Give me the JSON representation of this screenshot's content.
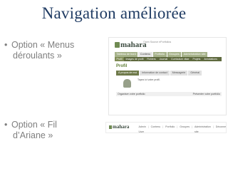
{
  "title": "Navigation améliorée",
  "bullets": [
    {
      "text_line1": "Option « Menus",
      "text_line2": "déroulants »"
    },
    {
      "text_line1": "Option « Fil",
      "text_line2": "d’Ariane »"
    }
  ],
  "screenshot_menus": {
    "logo": "mahara",
    "tagline": "Open Source ePortfolios",
    "top_menu": [
      "Tableau de bord",
      "Contenu",
      "Portfolio",
      "Groupes",
      "Administration site"
    ],
    "sub_menu": [
      "Profil",
      "Images de profil",
      "Fichiers",
      "Journal",
      "Curriculum vitae",
      "Projets",
      "Annotations"
    ],
    "heading": "Profil",
    "tabs": [
      "À propos de moi",
      "Information de contact",
      "Messagerie",
      "Général"
    ],
    "body_text": "Tapez ici votre profil.",
    "footer_left": "Organiser votre portfolio",
    "footer_right": "Présenter votre portfolio"
  },
  "screenshot_breadcrumb": {
    "logo": "mahara",
    "crumbs": [
      "Admin User",
      "Contenu",
      "Portfolio",
      "Groupes",
      "Administration site",
      "Déconnexion"
    ]
  }
}
